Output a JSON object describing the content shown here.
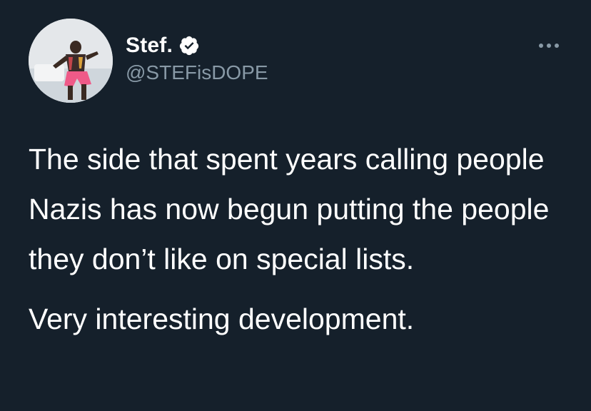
{
  "user": {
    "display_name": "Stef.",
    "handle": "@STEFisDOPE",
    "verified": true,
    "verified_color": "#ffffff"
  },
  "tweet": {
    "paragraphs": [
      "The side that spent years calling people Nazis has now begun putting the people they don’t like on special lists.",
      "Very interesting development."
    ]
  },
  "icons": {
    "verified": "verified-badge-icon",
    "more": "more-options-icon"
  },
  "colors": {
    "background": "#15202b",
    "text": "#ffffff",
    "secondary_text": "#8899a6"
  }
}
